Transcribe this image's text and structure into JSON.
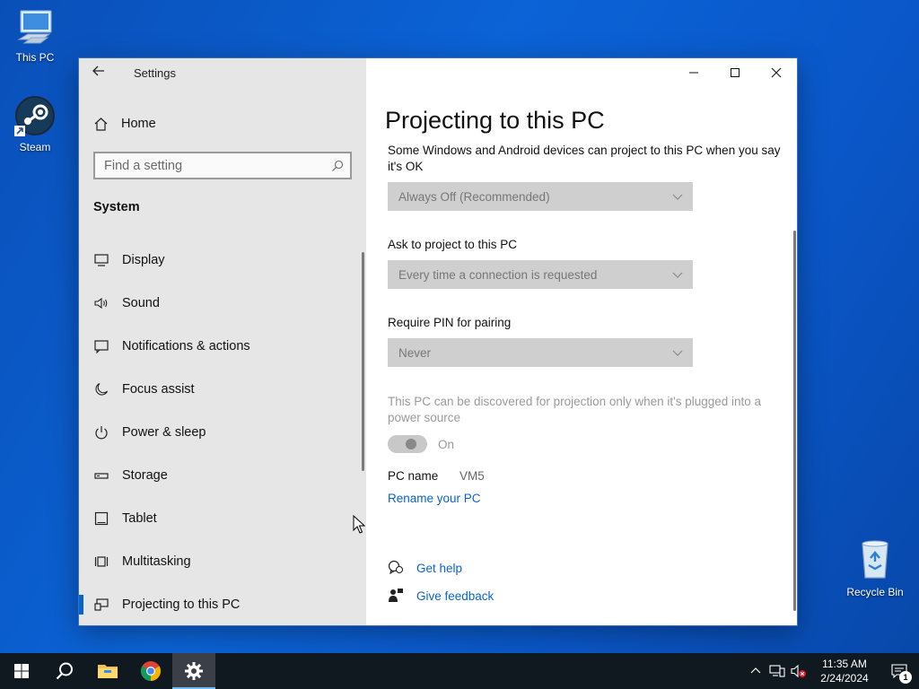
{
  "desktop": {
    "icons": [
      {
        "label": "This PC"
      },
      {
        "label": "Steam"
      },
      {
        "label": "Recycle Bin"
      }
    ]
  },
  "window": {
    "app_title": "Settings",
    "sidebar": {
      "home_label": "Home",
      "search_placeholder": "Find a setting",
      "section_title": "System",
      "items": [
        {
          "label": "Display",
          "icon": "monitor-icon"
        },
        {
          "label": "Sound",
          "icon": "speaker-icon"
        },
        {
          "label": "Notifications & actions",
          "icon": "notification-icon"
        },
        {
          "label": "Focus assist",
          "icon": "moon-icon"
        },
        {
          "label": "Power & sleep",
          "icon": "power-icon"
        },
        {
          "label": "Storage",
          "icon": "storage-icon"
        },
        {
          "label": "Tablet",
          "icon": "tablet-icon"
        },
        {
          "label": "Multitasking",
          "icon": "multitasking-icon"
        },
        {
          "label": "Projecting to this PC",
          "icon": "projecting-icon",
          "selected": true
        }
      ]
    },
    "main": {
      "title": "Projecting to this PC",
      "description": "Some Windows and Android devices can project to this PC when you say it's OK",
      "availability_value": "Always Off (Recommended)",
      "ask_label": "Ask to project to this PC",
      "ask_value": "Every time a connection is requested",
      "pin_label": "Require PIN for pairing",
      "pin_value": "Never",
      "plugged_text": "This PC can be discovered for projection only when it's plugged into a power source",
      "toggle_label": "On",
      "pc_name_label": "PC name",
      "pc_name_value": "VM5",
      "rename_link": "Rename your PC",
      "get_help": "Get help",
      "give_feedback": "Give feedback"
    }
  },
  "taskbar": {
    "time": "11:35 AM",
    "date": "2/24/2024",
    "notification_count": "1"
  },
  "colors": {
    "accent": "#0a64c8",
    "desktop": "#0b63d6",
    "taskbar": "#101820"
  }
}
